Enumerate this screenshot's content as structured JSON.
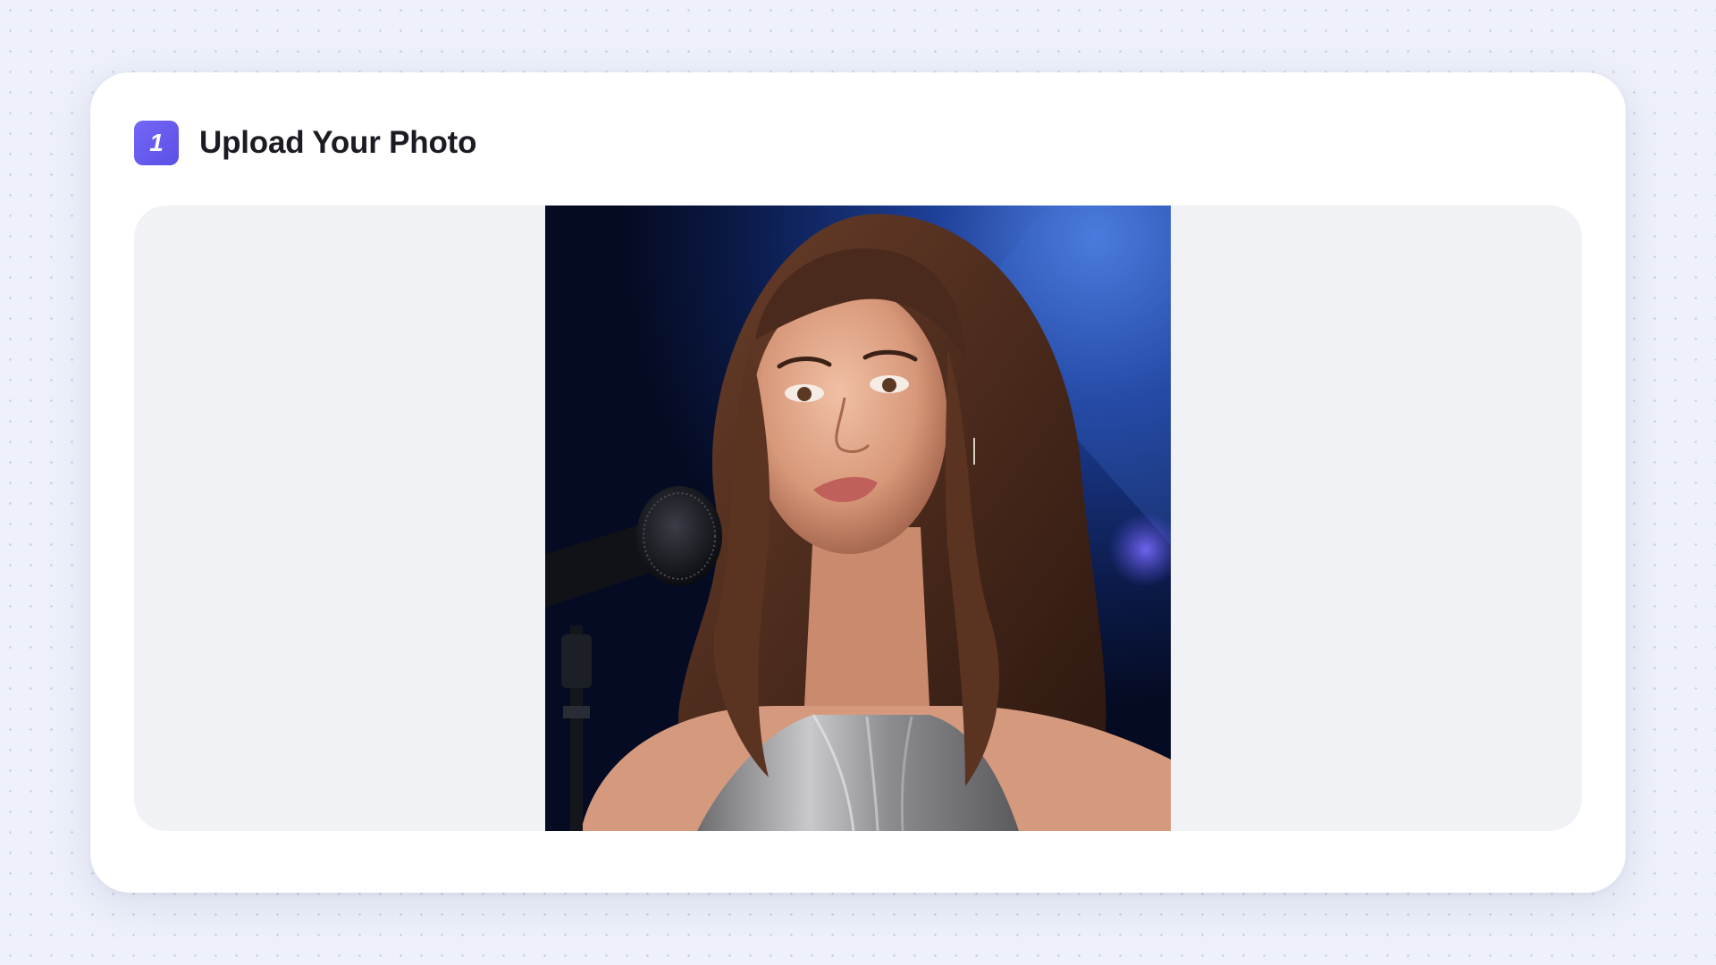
{
  "step": {
    "number": "1",
    "title": "Upload Your Photo"
  },
  "upload": {
    "photo_alt": "Uploaded photo"
  },
  "colors": {
    "accent": "#6a5ef2",
    "page_background": "#eef1fa",
    "card_background": "#ffffff",
    "upload_area_background": "#f0f2f6",
    "title_text": "#1b1c23"
  }
}
